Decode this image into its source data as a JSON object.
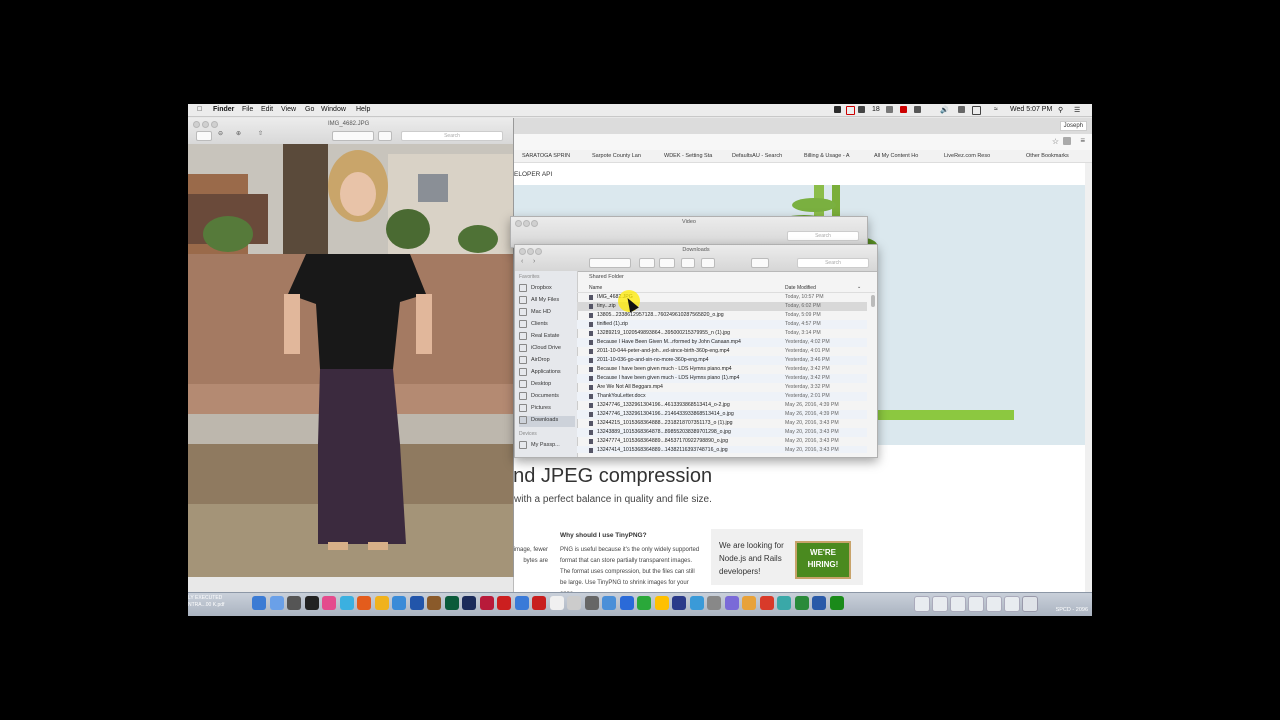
{
  "menubar": {
    "app": "Finder",
    "items": [
      "File",
      "Edit",
      "View",
      "Go",
      "Window",
      "Help"
    ],
    "battery_badge": "18",
    "clock": "Wed 5:07 PM",
    "user": "Joseph"
  },
  "browser": {
    "bookmarks": [
      "SARATOGA SPRIN",
      "Sarpote County Lan",
      "WDEK - Setting Sta",
      "DefaultsAU - Search",
      "Billing & Usage - A",
      "All My Content Ho",
      "LiveRez.com Reso",
      "Other Bookmarks"
    ],
    "page": {
      "breadcrumb": "ELOPER API",
      "heading": "and JPEG compression",
      "subheading": "with a perfect balance in quality and file size.",
      "why_heading": "Why should I use TinyPNG?",
      "why_text": "PNG is useful because it's the only widely supported format that can store partially transparent images. The format uses compression, but the files can still be large. Use TinyPNG to shrink images for your apps",
      "left_text": "sion f your the number of colors in the image, fewer bytes are",
      "hiring_text": "We are looking for Node.js and Rails developers!",
      "hiring_sign": "WE'RE HIRING!"
    }
  },
  "preview": {
    "title": "IMG_4682.JPG",
    "search_placeholder": "Search"
  },
  "finder_video": {
    "title": "Video",
    "search_placeholder": "Search"
  },
  "finder_downloads": {
    "title": "Downloads",
    "search_placeholder": "Search",
    "path_label": "Shared Folder",
    "col_name": "Name",
    "col_date": "Date Modified",
    "sidebar": {
      "favorites_label": "Favorites",
      "items": [
        "Dropbox",
        "All My Files",
        "Mac HD",
        "Clients",
        "Real Estate",
        "iCloud Drive",
        "AirDrop",
        "Applications",
        "Desktop",
        "Documents",
        "Pictures",
        "Downloads"
      ],
      "devices_label": "Devices",
      "devices": [
        "My Passp..."
      ]
    },
    "files": [
      {
        "name": "IMG_4682.JPG",
        "date": "Today, 10:57 PM"
      },
      {
        "name": "tiny...zip",
        "date": "Today, 6:02 PM"
      },
      {
        "name": "13805...23386129571​28...760249610287565820_o.jpg",
        "date": "Today, 5:09 PM"
      },
      {
        "name": "tinified (1).zip",
        "date": "Today, 4:57 PM"
      },
      {
        "name": "13289219_10205498938​64...395000215379955_n (1).jpg",
        "date": "Today, 3:14 PM"
      },
      {
        "name": "Because I Have Been Given M...rformed by John Canaan.mp4",
        "date": "Yesterday, 4:02 PM"
      },
      {
        "name": "2011-10-044-peter-and-joh...ed-since-birth-360p-eng.mp4",
        "date": "Yesterday, 4:01 PM"
      },
      {
        "name": "2011-10-036-go-and-sin-no-more-360p-eng.mp4",
        "date": "Yesterday, 3:46 PM"
      },
      {
        "name": "Because I have been given much - LDS Hymns piano.mp4",
        "date": "Yesterday, 3:42 PM"
      },
      {
        "name": "Because I have been given much - LDS Hymns piano (1).mp4",
        "date": "Yesterday, 3:42 PM"
      },
      {
        "name": "Are We Not All Beggars.mp4",
        "date": "Yesterday, 3:32 PM"
      },
      {
        "name": "ThankYouLetter.docx",
        "date": "Yesterday, 2:01 PM"
      },
      {
        "name": "13247746_1332961304196...4613393868513414_o-2.jpg",
        "date": "May 26, 2016, 4:39 PM"
      },
      {
        "name": "13247746_1332961304196...2146433933868513414_o.jpg",
        "date": "May 26, 2016, 4:39 PM"
      },
      {
        "name": "13244215_1015368364888...2318218707351173_o (1).jpg",
        "date": "May 20, 2016, 3:43 PM"
      },
      {
        "name": "13243889_1015368364878...8985520383897012​98_o.jpg",
        "date": "May 20, 2016, 3:43 PM"
      },
      {
        "name": "13247774_1015368364889...8453717092279889​0_o.jpg",
        "date": "May 20, 2016, 3:43 PM"
      },
      {
        "name": "13247414_1015368364889...14​38211​6​3​9​3​7​4​8​7​1​6_o.jpg",
        "date": "May 20, 2016, 3:43 PM"
      }
    ],
    "selected_index": 1
  },
  "dock": {
    "left_text_1": "LY EXECUTED",
    "left_text_2": "NTRA...00 K.pdf",
    "right_text": "SPCD - 2096",
    "icon_colors": [
      "#3b7bd4",
      "#6aa0e8",
      "#555555",
      "#222222",
      "#e44b8d",
      "#3bb0e0",
      "#e35c1c",
      "#f0b21c",
      "#3a8bd8",
      "#2255aa",
      "#8a5a2a",
      "#0a5a3a",
      "#1a2a5a",
      "#b81a3a",
      "#cc1f1f",
      "#3a7ad8",
      "#c81f1f",
      "#f0f0f0",
      "#cccccc",
      "#666666",
      "#4a8fd8",
      "#2a6ad8",
      "#2aa83a",
      "#ffc000",
      "#2a3a8a",
      "#3a9ad8",
      "#888888",
      "#7a6ad8",
      "#e8a23a",
      "#d83a2a",
      "#3aa8a8",
      "#2a8a3a",
      "#2a5aa8",
      "#1a8a1a"
    ]
  }
}
